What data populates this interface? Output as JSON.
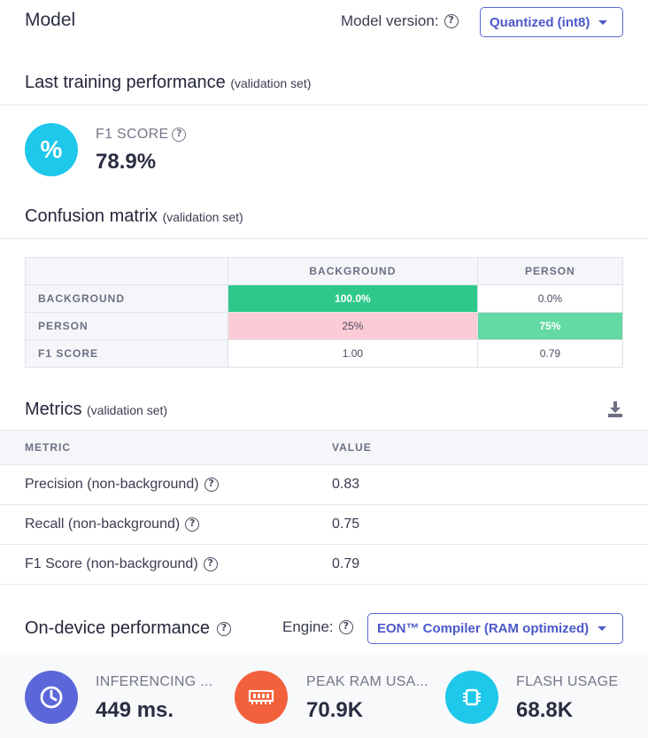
{
  "header": {
    "title": "Model",
    "version_label": "Model version:",
    "version_value": "Quantized (int8)"
  },
  "training": {
    "title": "Last training performance",
    "subtitle": "(validation set)",
    "f1_label": "F1 SCORE",
    "f1_value": "78.9%",
    "icon_glyph": "%"
  },
  "confusion": {
    "title": "Confusion matrix",
    "subtitle": "(validation set)",
    "columns": [
      "BACKGROUND",
      "PERSON"
    ],
    "rows": [
      {
        "label": "BACKGROUND",
        "cells": [
          "100.0%",
          "0.0%"
        ]
      },
      {
        "label": "PERSON",
        "cells": [
          "25%",
          "75%"
        ]
      },
      {
        "label": "F1 SCORE",
        "cells": [
          "1.00",
          "0.79"
        ]
      }
    ],
    "colors": {
      "high": "#2ec98a",
      "mid": "#63d9a3",
      "low": "#fbccd6"
    }
  },
  "metrics": {
    "title": "Metrics",
    "subtitle": "(validation set)",
    "col_metric": "METRIC",
    "col_value": "VALUE",
    "rows": [
      {
        "metric": "Precision (non-background)",
        "value": "0.83"
      },
      {
        "metric": "Recall (non-background)",
        "value": "0.75"
      },
      {
        "metric": "F1 Score (non-background)",
        "value": "0.79"
      }
    ]
  },
  "device": {
    "title": "On-device performance",
    "engine_label": "Engine:",
    "engine_value": "EON™ Compiler (RAM optimized)",
    "kpis": [
      {
        "label": "INFERENCING ...",
        "value": "449 ms.",
        "icon": "clock-icon",
        "color": "#5b67d8"
      },
      {
        "label": "PEAK RAM USA...",
        "value": "70.9K",
        "icon": "ram-icon",
        "color": "#f2603c"
      },
      {
        "label": "FLASH USAGE",
        "value": "68.8K",
        "icon": "chip-icon",
        "color": "#1ec8ea"
      }
    ]
  },
  "help_glyph": "?"
}
